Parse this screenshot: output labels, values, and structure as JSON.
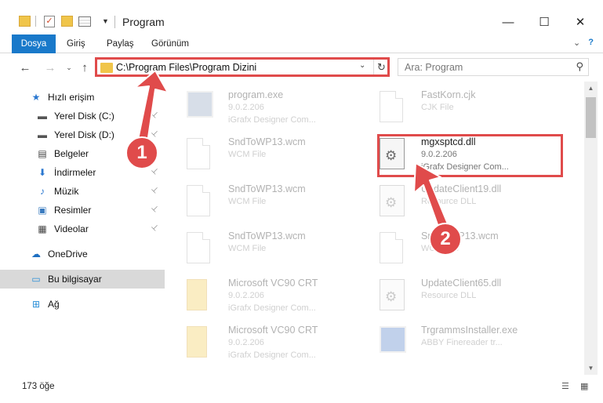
{
  "window": {
    "title": "Program",
    "minimize_glyph": "—",
    "maximize_glyph": "☐",
    "close_glyph": "✕"
  },
  "ribbon": {
    "tabs": [
      "Dosya",
      "Giriş",
      "Paylaş",
      "Görünüm"
    ]
  },
  "address": {
    "path": "C:\\Program Files\\Program Dizini",
    "dropdown_glyph": "⌄",
    "refresh_glyph": "↻"
  },
  "search": {
    "placeholder": "Ara: Program",
    "icon": "search-icon"
  },
  "nav": {
    "back": "←",
    "forward": "→",
    "recent": "⌄",
    "up": "↑"
  },
  "sidebar": {
    "items": [
      {
        "label": "Hızlı erişim",
        "icon": "star-icon",
        "glyph": "★",
        "color": "#2b78d0",
        "pinned": false
      },
      {
        "label": "Yerel Disk (C:)",
        "icon": "drive-icon",
        "glyph": "▬",
        "color": "#555555",
        "pinned": true
      },
      {
        "label": "Yerel Disk (D:)",
        "icon": "drive-icon",
        "glyph": "▬",
        "color": "#555555",
        "pinned": true
      },
      {
        "label": "Belgeler",
        "icon": "documents-icon",
        "glyph": "▤",
        "color": "#444444",
        "pinned": true
      },
      {
        "label": "İndirmeler",
        "icon": "download-icon",
        "glyph": "⬇",
        "color": "#2b78d0",
        "pinned": true
      },
      {
        "label": "Müzik",
        "icon": "music-icon",
        "glyph": "♪",
        "color": "#2b78d0",
        "pinned": true
      },
      {
        "label": "Resimler",
        "icon": "pictures-icon",
        "glyph": "▣",
        "color": "#3a7bbf",
        "pinned": true
      },
      {
        "label": "Videolar",
        "icon": "videos-icon",
        "glyph": "▦",
        "color": "#444444",
        "pinned": true
      },
      {
        "label": "OneDrive",
        "icon": "cloud-icon",
        "glyph": "☁",
        "color": "#1e6fc1",
        "pinned": false
      },
      {
        "label": "Bu bilgisayar",
        "icon": "computer-icon",
        "glyph": "▭",
        "color": "#2a8fd8",
        "pinned": false
      },
      {
        "label": "Ağ",
        "icon": "network-icon",
        "glyph": "⊞",
        "color": "#2a8fd8",
        "pinned": false
      }
    ],
    "pin_glyph": "📌"
  },
  "files": {
    "left": [
      {
        "name": "program.exe",
        "line2": "9.0.2.206",
        "line3": "iGrafx Designer Com...",
        "kind": "exe",
        "faded": true
      },
      {
        "name": "SndToWP13.wcm",
        "line2": "WCM File",
        "line3": "",
        "kind": "page",
        "faded": true
      },
      {
        "name": "SndToWP13.wcm",
        "line2": "WCM File",
        "line3": "",
        "kind": "page",
        "faded": true
      },
      {
        "name": "SndToWP13.wcm",
        "line2": "WCM File",
        "line3": "",
        "kind": "page",
        "faded": true
      },
      {
        "name": "Microsoft VC90 CRT",
        "line2": "9.0.2.206",
        "line3": "iGrafx Designer Com...",
        "kind": "folder",
        "faded": true
      },
      {
        "name": "Microsoft VC90 CRT",
        "line2": "9.0.2.206",
        "line3": "iGrafx Designer Com...",
        "kind": "folder",
        "faded": true
      }
    ],
    "right": [
      {
        "name": "FastKorn.cjk",
        "line2": "CJK File",
        "line3": "",
        "kind": "page",
        "faded": true
      },
      {
        "name": "mgxsptcd.dll",
        "line2": "9.0.2.206",
        "line3": "iGrafx Designer Com...",
        "kind": "dll",
        "faded": false
      },
      {
        "name": "UpdateClient19.dll",
        "line2": "Resource DLL",
        "line3": "",
        "kind": "dll",
        "faded": true
      },
      {
        "name": "SndToWP13.wcm",
        "line2": "WCM File",
        "line3": "",
        "kind": "page",
        "faded": true
      },
      {
        "name": "UpdateClient65.dll",
        "line2": "Resource DLL",
        "line3": "",
        "kind": "dll",
        "faded": true
      },
      {
        "name": "TrgrammsInstaller.exe",
        "line2": "ABBY Finereader tr...",
        "line3": "",
        "kind": "exe2",
        "faded": true
      }
    ]
  },
  "status": {
    "count": "173 öğe"
  },
  "annotations": {
    "badge1": "1",
    "badge2": "2",
    "color": "#e04b4b"
  }
}
